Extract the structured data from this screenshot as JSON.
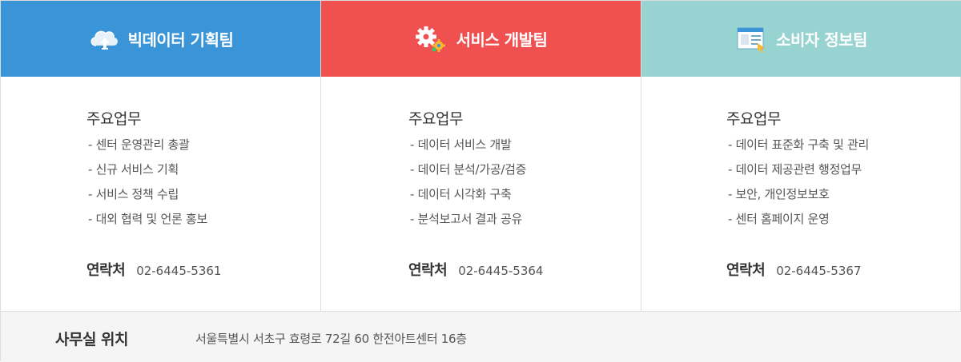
{
  "teams": [
    {
      "name": "빅데이터 기획팀",
      "icon": "cloud-upload-icon",
      "color": "#3a95d8",
      "duty_title": "주요업무",
      "duties": [
        "센터 운영관리 총괄",
        "신규 서비스 기획",
        "서비스 정책 수립",
        "대외 협력 및 언론 홍보"
      ],
      "contact_label": "연락처",
      "phone": "02-6445-5361"
    },
    {
      "name": "서비스 개발팀",
      "icon": "gears-icon",
      "color": "#f0504f",
      "duty_title": "주요업무",
      "duties": [
        "데이터 서비스 개발",
        "데이터 분석/가공/검증",
        "데이터 시각화 구축",
        "분석보고서 결과 공유"
      ],
      "contact_label": "연락처",
      "phone": "02-6445-5364"
    },
    {
      "name": "소비자 정보팀",
      "icon": "browser-window-icon",
      "color": "#97d3d1",
      "duty_title": "주요업무",
      "duties": [
        "데이터 표준화 구축 및 관리",
        "데이터 제공관련 행정업무",
        "보안, 개인정보보호",
        "센터 홈페이지 운영"
      ],
      "contact_label": "연락처",
      "phone": "02-6445-5367"
    }
  ],
  "office": {
    "label": "사무실 위치",
    "address": "서울특별시 서초구 효령로 72길 60 한전아트센터 16층"
  }
}
